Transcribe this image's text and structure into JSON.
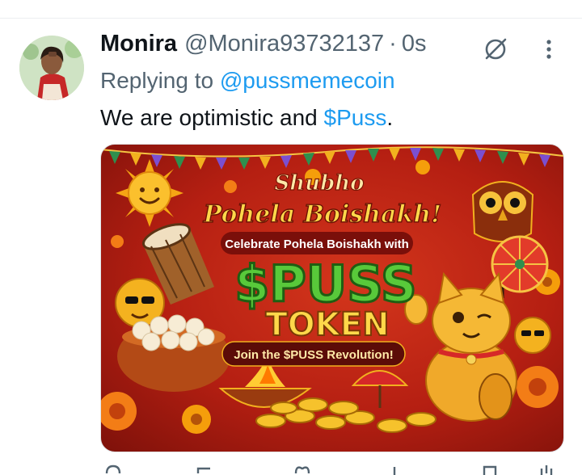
{
  "tweet": {
    "display_name": "Monira",
    "handle": "@Monira93732137",
    "separator": "·",
    "time": "0s",
    "replying_prefix": "Replying to ",
    "replying_to": "@pussmemecoin",
    "text_before": "We are optimistic and ",
    "cashtag": "$Puss",
    "text_after": "."
  },
  "media": {
    "greeting_line1": "Shubho",
    "greeting_line2": "Pohela Boishakh!",
    "subtitle": "Celebrate Pohela Boishakh with",
    "token_name": "$PUSS",
    "token_word": "TOKEN",
    "cta": "Join the $PUSS Revolution!"
  },
  "colors": {
    "text_primary": "#0f1419",
    "text_secondary": "#536471",
    "link": "#1d9bf0"
  },
  "icons": {
    "grok": "grok-icon",
    "more": "more-vertical-icon"
  }
}
